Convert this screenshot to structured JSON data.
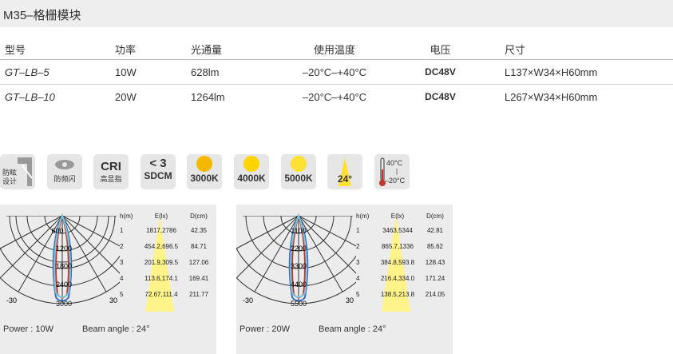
{
  "page": {
    "title": "M35–格栅模块"
  },
  "spec_table": {
    "headers": [
      "型号",
      "功率",
      "光通量",
      "使用温度",
      "电压",
      "尺寸"
    ],
    "rows": [
      [
        "GT–LB–5",
        "10W",
        "628lm",
        "–20°C–+40°C",
        "DC48V",
        "L137×W34×H60mm"
      ],
      [
        "GT–LB–10",
        "20W",
        "1264lm",
        "–20°C–+40°C",
        "DC48V",
        "L267×W34×H60mm"
      ]
    ]
  },
  "icons": [
    {
      "name": "anti-glare-design-icon",
      "line1": "防眩",
      "line2": "设计"
    },
    {
      "name": "flicker-free-icon",
      "label": "防频闪"
    },
    {
      "name": "cri-icon",
      "big": "CRI",
      "label": "高显指"
    },
    {
      "name": "sdcm-icon",
      "big": "< 3",
      "label": "SDCM"
    },
    {
      "name": "cct-3000k-icon",
      "label": "3000K",
      "color": "#f5b800"
    },
    {
      "name": "cct-4000k-icon",
      "label": "4000K",
      "color": "#ffd400"
    },
    {
      "name": "cct-5000k-icon",
      "label": "5000K",
      "color": "#ffe033"
    },
    {
      "name": "beam-angle-icon",
      "label": "24°",
      "color": "#ffe033"
    },
    {
      "name": "temperature-range-icon",
      "top": "40°C",
      "bottom": "–20°C"
    }
  ],
  "panels": [
    {
      "polar_labels": [
        "600",
        "1200",
        "1800",
        "2400",
        "3000"
      ],
      "left_angle": "-30",
      "right_angle": "30",
      "table_headers": [
        "h(m)",
        "E(lx)",
        "D(cm)"
      ],
      "rows": [
        [
          "1",
          "1817,2786",
          "42.35"
        ],
        [
          "2",
          "454.2,696.5",
          "84.71"
        ],
        [
          "3",
          "201.9,309.5",
          "127.06"
        ],
        [
          "4",
          "113.6,174.1",
          "169.41"
        ],
        [
          "5",
          "72.67,111.4",
          "211.77"
        ]
      ],
      "power": "Power : 10W",
      "beam": "Beam angle : 24°"
    },
    {
      "polar_labels": [
        "1100",
        "2200",
        "3300",
        "4400",
        "5500"
      ],
      "left_angle": "-30",
      "right_angle": "30",
      "table_headers": [
        "h(m)",
        "E(lx)",
        "D(cm)"
      ],
      "rows": [
        [
          "1",
          "3463,5344",
          "42.81"
        ],
        [
          "2",
          "865.7,1336",
          "85.62"
        ],
        [
          "3",
          "384.8,593.8",
          "128.43"
        ],
        [
          "4",
          "216.4,334.0",
          "171.24"
        ],
        [
          "5",
          "138.5,213.8",
          "214.05"
        ]
      ],
      "power": "Power : 20W",
      "beam": "Beam angle : 24°"
    }
  ]
}
